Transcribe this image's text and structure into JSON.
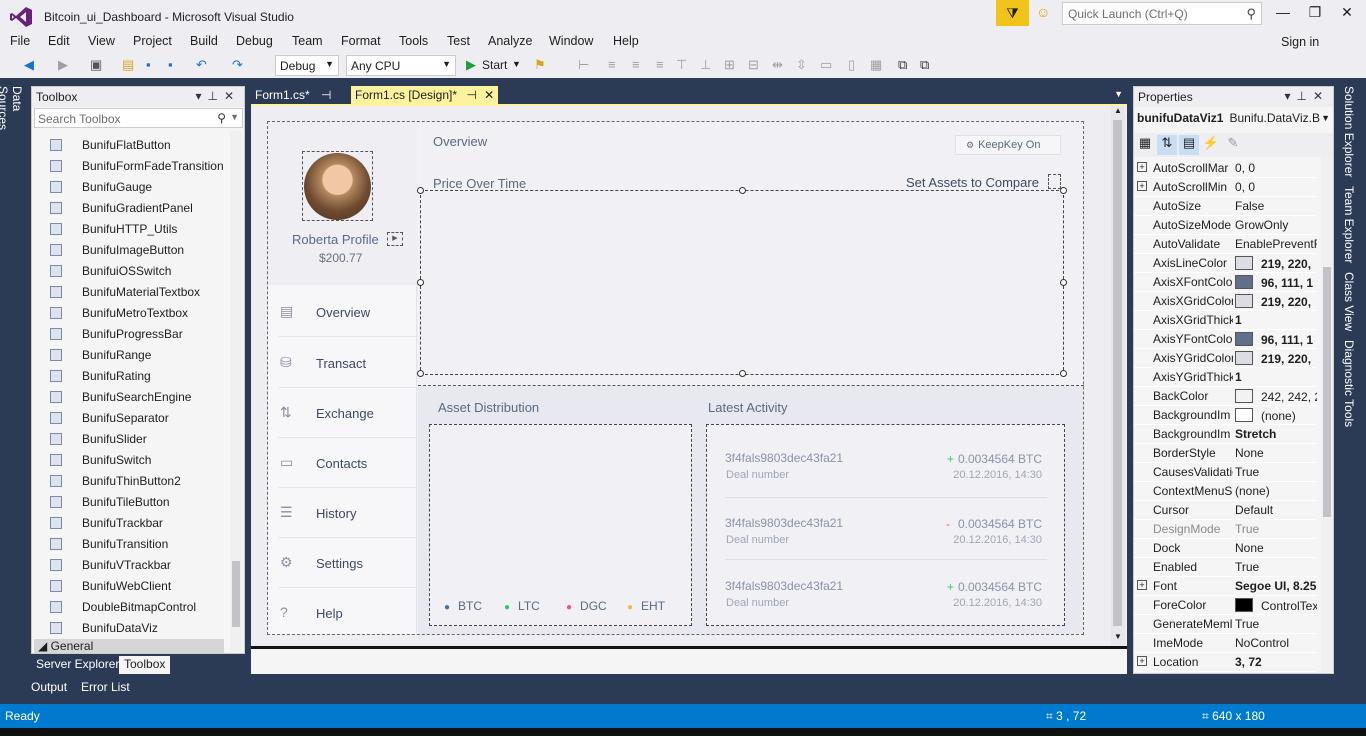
{
  "window": {
    "title": "Bitcoin_ui_Dashboard - Microsoft Visual Studio",
    "quick_launch_placeholder": "Quick Launch (Ctrl+Q)",
    "sign_in": "Sign in"
  },
  "menu": [
    "File",
    "Edit",
    "View",
    "Project",
    "Build",
    "Debug",
    "Team",
    "Format",
    "Tools",
    "Test",
    "Analyze",
    "Window",
    "Help"
  ],
  "toolbar": {
    "config": "Debug",
    "platform": "Any CPU",
    "start": "Start"
  },
  "left_tab": "Data Sources",
  "toolbox": {
    "title": "Toolbox",
    "search_placeholder": "Search Toolbox",
    "items": [
      "BunifuFlatButton",
      "BunifuFormFadeTransition",
      "BunifuGauge",
      "BunifuGradientPanel",
      "BunifuHTTP_Utils",
      "BunifuImageButton",
      "BunifuiOSSwitch",
      "BunifuMaterialTextbox",
      "BunifuMetroTextbox",
      "BunifuProgressBar",
      "BunifuRange",
      "BunifuRating",
      "BunifuSearchEngine",
      "BunifuSeparator",
      "BunifuSlider",
      "BunifuSwitch",
      "BunifuThinButton2",
      "BunifuTileButton",
      "BunifuTrackbar",
      "BunifuTransition",
      "BunifuVTrackbar",
      "BunifuWebClient",
      "DoubleBitmapControl",
      "BunifuDataViz"
    ],
    "general": "General",
    "bottom_tabs": [
      "Server Explorer",
      "Toolbox"
    ]
  },
  "output_tabs": [
    "Output",
    "Error List"
  ],
  "doc_tabs": [
    "Form1.cs*",
    "Form1.cs [Design]*"
  ],
  "form": {
    "profile_name": "Roberta Profile",
    "profile_amount": "$200.77",
    "nav": [
      "Overview",
      "Transact",
      "Exchange",
      "Contacts",
      "History",
      "Settings",
      "Help"
    ],
    "overview_label": "Overview",
    "keepkey": "KeepKey On",
    "price_label": "Price Over Time",
    "set_assets": "Set Assets to Compare",
    "asset_label": "Asset Distribution",
    "activity_label": "Latest Activity",
    "legend": [
      {
        "name": "BTC",
        "color": "#4a6fa5"
      },
      {
        "name": "LTC",
        "color": "#2ecc71"
      },
      {
        "name": "DGC",
        "color": "#ef5777"
      },
      {
        "name": "EHT",
        "color": "#f5b942"
      }
    ],
    "activity": [
      {
        "hash": "3f4fals9803dec43fa21",
        "deal": "Deal number",
        "sign": "+",
        "amount": "0.0034564 BTC",
        "date": "20.12.2016, 14:30"
      },
      {
        "hash": "3f4fals9803dec43fa21",
        "deal": "Deal number",
        "sign": "-",
        "amount": "0.0034564 BTC",
        "date": "20.12.2016, 14:30"
      },
      {
        "hash": "3f4fals9803dec43fa21",
        "deal": "Deal number",
        "sign": "+",
        "amount": "0.0034564 BTC",
        "date": "20.12.2016, 14:30"
      }
    ]
  },
  "properties": {
    "title": "Properties",
    "object": "bunifuDataViz1",
    "object_type": "Bunifu.DataViz.B",
    "rows": [
      {
        "name": "AutoScrollMar",
        "value": "0, 0",
        "expand": true
      },
      {
        "name": "AutoScrollMin",
        "value": "0, 0",
        "expand": true
      },
      {
        "name": "AutoSize",
        "value": "False"
      },
      {
        "name": "AutoSizeMode",
        "value": "GrowOnly"
      },
      {
        "name": "AutoValidate",
        "value": "EnablePreventF"
      },
      {
        "name": "AxisLineColor",
        "value": "219, 220,",
        "swatch": "#dbdce4",
        "bold": true
      },
      {
        "name": "AxisXFontColo",
        "value": "96, 111, 1",
        "swatch": "#606f8a",
        "bold": true
      },
      {
        "name": "AxisXGridColor",
        "value": "219, 220,",
        "swatch": "#dbdce4",
        "bold": true
      },
      {
        "name": "AxisXGridThick",
        "value": "1",
        "bold": true
      },
      {
        "name": "AxisYFontColo",
        "value": "96, 111, 1",
        "swatch": "#606f8a",
        "bold": true
      },
      {
        "name": "AxisYGridColor",
        "value": "219, 220,",
        "swatch": "#dbdce4",
        "bold": true
      },
      {
        "name": "AxisYGridThick",
        "value": "1",
        "bold": true
      },
      {
        "name": "BackColor",
        "value": "242, 242, 2",
        "swatch": "#f2f2f2"
      },
      {
        "name": "BackgroundIm",
        "value": "(none)",
        "swatch": "#ffffff"
      },
      {
        "name": "BackgroundIm",
        "value": "Stretch",
        "bold": true
      },
      {
        "name": "BorderStyle",
        "value": "None"
      },
      {
        "name": "CausesValidatio",
        "value": "True"
      },
      {
        "name": "ContextMenuS",
        "value": "(none)"
      },
      {
        "name": "Cursor",
        "value": "Default"
      },
      {
        "name": "DesignMode",
        "value": "True",
        "dim": true
      },
      {
        "name": "Dock",
        "value": "None"
      },
      {
        "name": "Enabled",
        "value": "True"
      },
      {
        "name": "Font",
        "value": "Segoe UI, 8.25",
        "expand": true,
        "bold": true
      },
      {
        "name": "ForeColor",
        "value": "ControlTex",
        "swatch": "#000000"
      },
      {
        "name": "GenerateMeml",
        "value": "True"
      },
      {
        "name": "ImeMode",
        "value": "NoControl"
      },
      {
        "name": "Location",
        "value": "3, 72",
        "expand": true,
        "bold": true
      }
    ]
  },
  "right_tabs": [
    "Solution Explorer",
    "Team Explorer",
    "Class View",
    "Diagnostic Tools"
  ],
  "status": {
    "ready": "Ready",
    "position": "3 , 72",
    "size": "640 x 180"
  }
}
